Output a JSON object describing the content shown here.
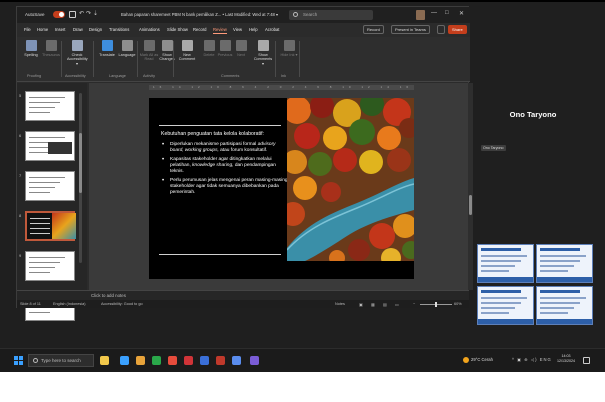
{
  "titlebar": {
    "autosave_label": "AutoSave",
    "doc_title": "Bahan paparan sharemeet PBM N bank pemilikan Z... • Last Modified: Wed at 7:48 ▾",
    "search_placeholder": "Search",
    "minimize": "—",
    "maximize": "□",
    "close": "✕"
  },
  "menu": {
    "tabs": [
      "File",
      "Home",
      "Insert",
      "Draw",
      "Design",
      "Transitions",
      "Animations",
      "Slide Show",
      "Record",
      "Review",
      "View",
      "Help",
      "Acrobat"
    ],
    "active_tab": "Review",
    "record_button": "Record",
    "present_button": "Present in Teams",
    "share_button": "Share"
  },
  "ribbon": {
    "buttons": [
      {
        "label": "Spelling",
        "color": "#7e93b7",
        "dim": false
      },
      {
        "label": "Thesaurus",
        "color": "#6b6b6b",
        "dim": true
      },
      {
        "label": "Check Accessibility ▾",
        "color": "#9aa7bd",
        "dim": false
      },
      {
        "label": "Translate",
        "color": "#3e8ede",
        "dim": false
      },
      {
        "label": "Language",
        "color": "#8e8e8e",
        "dim": false
      },
      {
        "label": "Mark All as Read",
        "color": "#6b6b6b",
        "dim": true
      },
      {
        "label": "Show Changes",
        "color": "#8e8e8e",
        "dim": false
      },
      {
        "label": "New Comment",
        "color": "#a9a9a9",
        "dim": false
      },
      {
        "label": "Delete",
        "color": "#6b6b6b",
        "dim": true
      },
      {
        "label": "Previous",
        "color": "#6b6b6b",
        "dim": true
      },
      {
        "label": "Next",
        "color": "#6b6b6b",
        "dim": true
      },
      {
        "label": "Show Comments ▾",
        "color": "#a9a9a9",
        "dim": false
      },
      {
        "label": "Hide Ink ▾",
        "color": "#6b6b6b",
        "dim": true
      }
    ],
    "groups": [
      "Proofing",
      "Accessibility",
      "Language",
      "Activity",
      "Comments",
      "Ink"
    ]
  },
  "thumbnails": {
    "slides": [
      {
        "number": "5",
        "selected": false
      },
      {
        "number": "6",
        "selected": false
      },
      {
        "number": "7",
        "selected": false
      },
      {
        "number": "8",
        "selected": true
      },
      {
        "number": "9",
        "selected": false
      },
      {
        "number": "10",
        "selected": false
      }
    ]
  },
  "slide": {
    "heading": "Kebutuhan penguatan tata kelola kolaboratif:",
    "bullets": [
      {
        "pre": "Diperlukan mekanisme partisipasi formal ",
        "em": "advisory board, working groups,",
        "post": " atau forum konsultatif."
      },
      {
        "pre": "Kapasitas stakeholder agar ditingkatkan melalui pelatihan, ",
        "em": "knowledge sharing,",
        "post": " dan pendampingan teknis."
      },
      {
        "pre": "Perlu perumusan jelas mengenai peran masing-masing stakeholder agar tidak semuanya dibebankan pada pemerintah.",
        "em": "",
        "post": ""
      }
    ]
  },
  "notes_placeholder": "Click to add notes",
  "statusbar": {
    "slide_counter": "Slide 8 of 11",
    "language": "English (Indonesia)",
    "accessibility": "Accessibility: Good to go",
    "notes": "Notes",
    "zoom": "60%"
  },
  "meeting": {
    "speaker_name": "Ono Taryono",
    "self_label": "Ono Taryono"
  },
  "taskbar": {
    "search_placeholder": "Type here to search",
    "weather": "29°C Cerah",
    "tray": "^ ▣ ⊕ ◁) ENG",
    "time": "14:03",
    "date": "12/13/2024",
    "app_colors": [
      "#f2c84b",
      "#3aa0ff",
      "#e8a33a",
      "#2aa84a",
      "#e74c3c",
      "#d13438",
      "#3a6fd8",
      "#c0392b",
      "#5a8dee",
      "#7a5cd6"
    ]
  }
}
